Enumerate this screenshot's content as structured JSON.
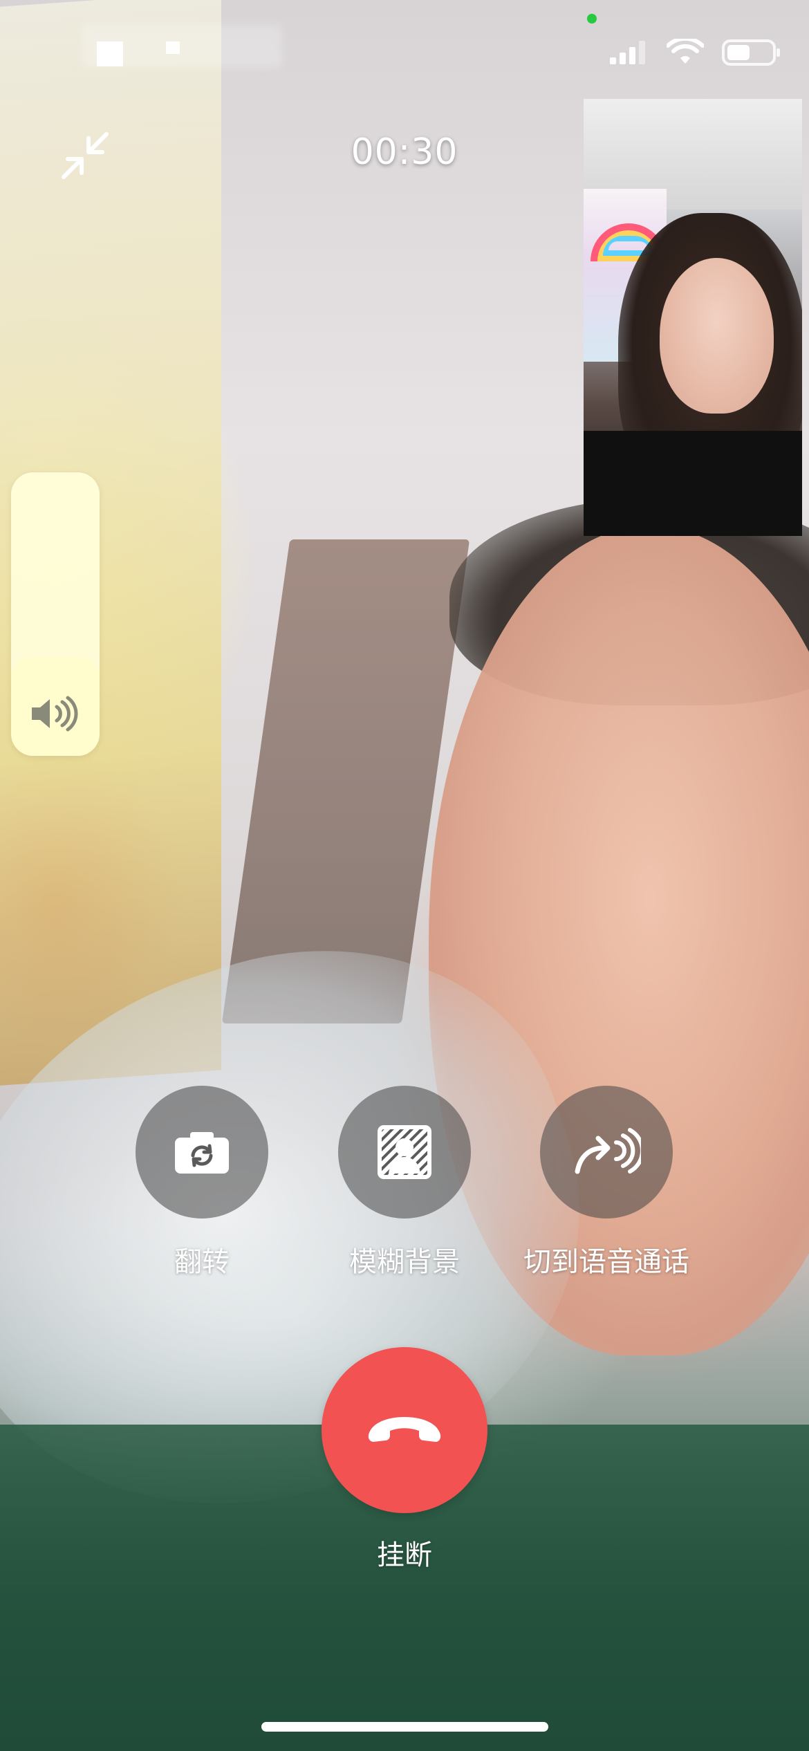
{
  "call": {
    "timer": "00:30",
    "volume_level": 0.35
  },
  "controls": {
    "flip_label": "翻转",
    "blur_label": "模糊背景",
    "voice_label": "切到语音通话",
    "hangup_label": "挂断"
  },
  "icons": {
    "minimize": "minimize-icon",
    "flip": "camera-flip-icon",
    "blur": "blur-background-icon",
    "voice": "switch-to-voice-icon",
    "hangup": "phone-hangup-icon",
    "volume": "speaker-icon",
    "signal": "cellular-signal-icon",
    "wifi": "wifi-icon",
    "battery": "battery-icon"
  },
  "colors": {
    "hangup": "#f25252",
    "control_bg": "rgba(70,70,70,0.55)",
    "privacy_dot": "#27c93f"
  }
}
